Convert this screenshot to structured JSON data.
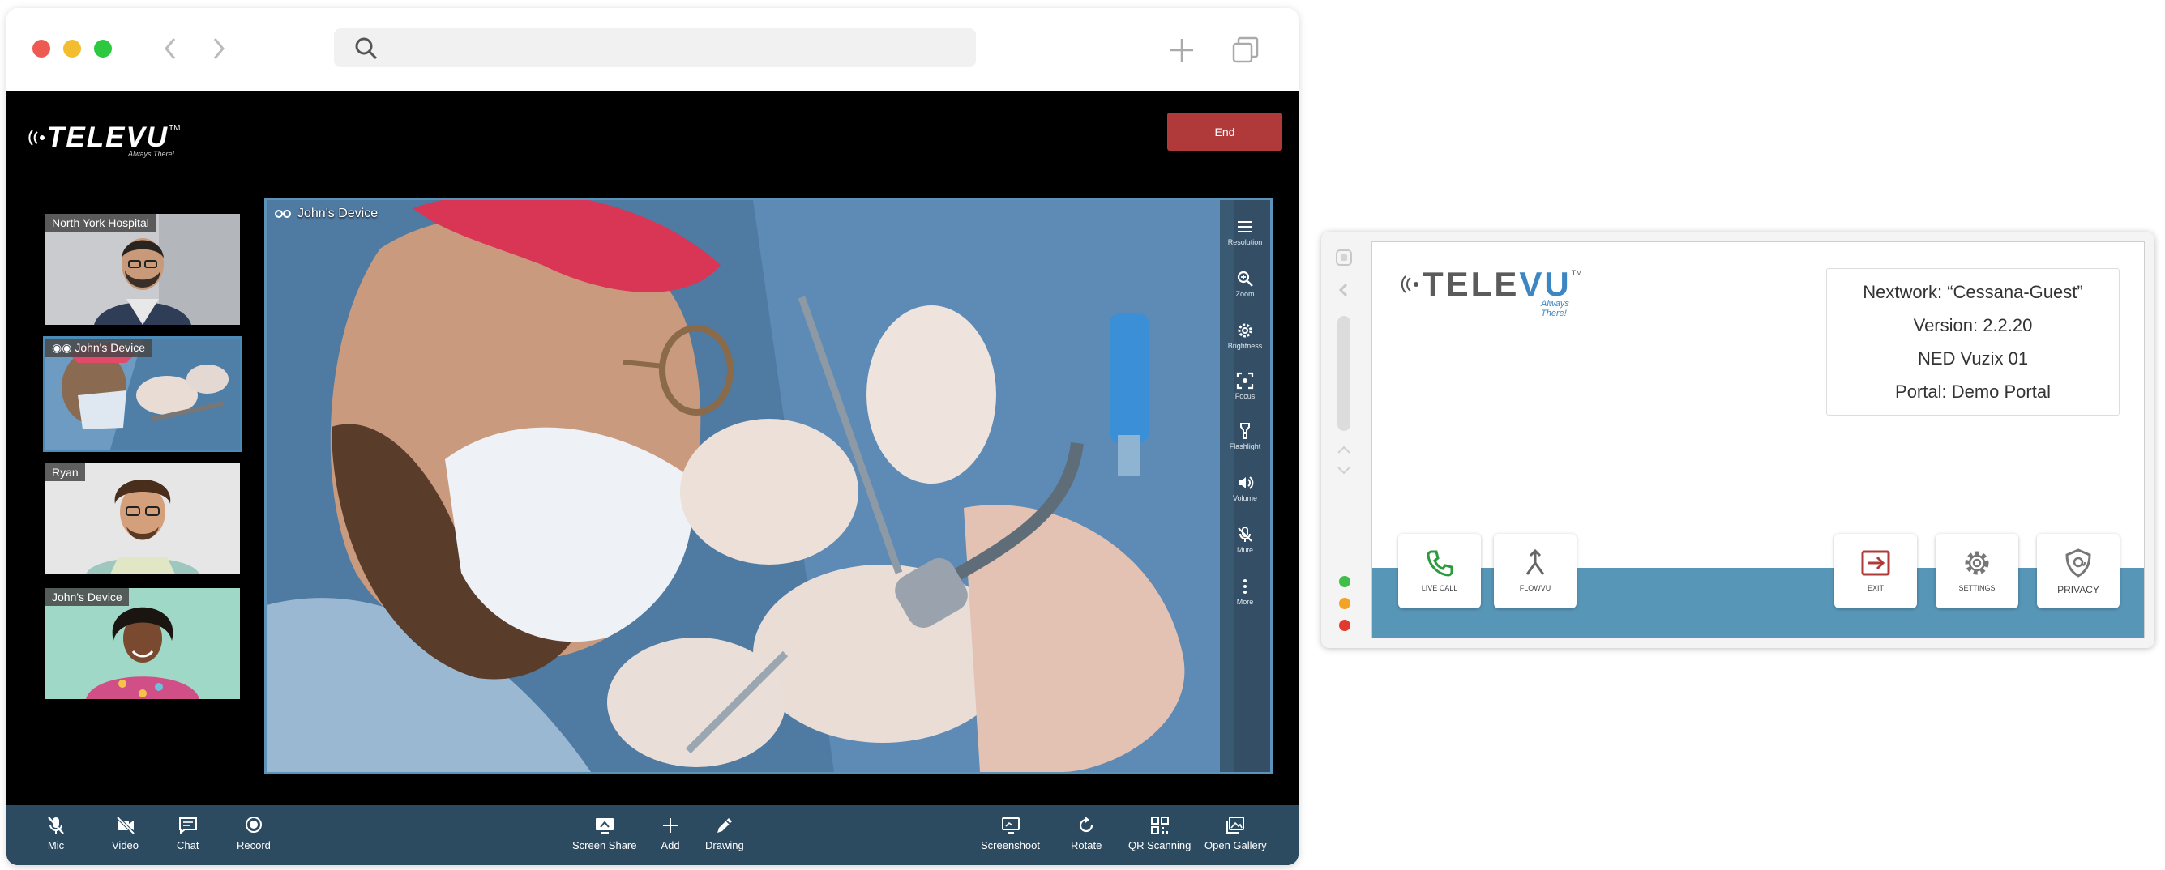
{
  "browser": {
    "url": ""
  },
  "call": {
    "logo_text": "TELEVU",
    "logo_tagline": "Always There!",
    "end_label": "End",
    "participants": [
      {
        "label": "North York Hospital",
        "active": false
      },
      {
        "label": "John's Device",
        "active": true
      },
      {
        "label": "Ryan",
        "active": false
      },
      {
        "label": "John's Device",
        "active": false
      }
    ],
    "main_label": "John's Device",
    "tools": [
      "Resolution",
      "Zoom",
      "Brightness",
      "Focus",
      "Flashlight",
      "Volume",
      "Mute",
      "More"
    ],
    "bottom_left": [
      "Mic",
      "Video",
      "Chat",
      "Record"
    ],
    "bottom_center": [
      "Screen Share",
      "Add",
      "Drawing"
    ],
    "bottom_right": [
      "Screenshoot",
      "Rotate",
      "QR Scanning",
      "Open Gallery"
    ]
  },
  "device": {
    "logo_gray": "TELE",
    "logo_blue": "VU",
    "logo_tagline": "Always There!",
    "info": {
      "network": "Nextwork: “Cessana-Guest”",
      "version": "Version: 2.2.20",
      "device": "NED Vuzix 01",
      "portal": "Portal: Demo Portal"
    },
    "buttons": {
      "live_call": "LIVE CALL",
      "flowvu": "FLOWVU",
      "exit": "EXIT",
      "settings": "SETTINGS",
      "privacy": "PRIVACY"
    }
  },
  "colors": {
    "accent_blue": "#5896b8",
    "end_red": "#b03a3a",
    "bar_navy": "#2d4b60",
    "call_green": "#2e9a3e"
  }
}
